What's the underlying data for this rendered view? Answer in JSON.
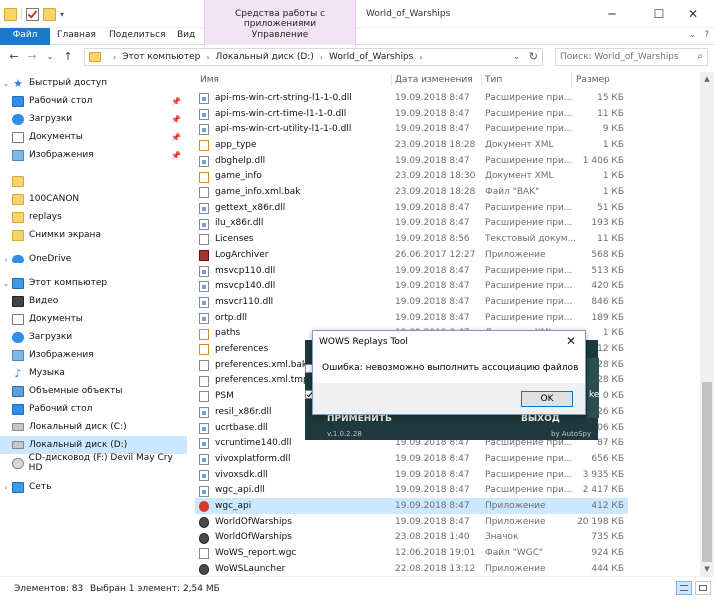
{
  "window": {
    "title": "World_of_Warships",
    "tools_label": "Средства работы с приложениями"
  },
  "ribbon": {
    "tabs": [
      "Файл",
      "Главная",
      "Поделиться",
      "Вид"
    ],
    "manage_label": "Управление"
  },
  "address": {
    "crumbs": [
      "Этот компьютер",
      "Локальный диск (D:)",
      "World_of_Warships"
    ],
    "search_placeholder": "Поиск: World_of_Warships"
  },
  "nav": [
    {
      "label": "Быстрый доступ",
      "icon": "star-icon"
    },
    {
      "label": "Рабочий стол",
      "icon": "desktop-icon",
      "pinned": true
    },
    {
      "label": "Загрузки",
      "icon": "downloads-icon",
      "pinned": true
    },
    {
      "label": "Документы",
      "icon": "documents-icon",
      "pinned": true
    },
    {
      "label": "Изображения",
      "icon": "images-icon",
      "pinned": true
    },
    {
      "label": "",
      "icon": "folder-icon"
    },
    {
      "label": "100CANON",
      "icon": "folder-icon"
    },
    {
      "label": "replays",
      "icon": "folder-icon"
    },
    {
      "label": "Снимки экрана",
      "icon": "folder-icon"
    },
    {
      "label": "OneDrive",
      "icon": "onedrive-icon"
    },
    {
      "label": "Этот компьютер",
      "icon": "computer-icon"
    },
    {
      "label": "Видео",
      "icon": "video-icon"
    },
    {
      "label": "Документы",
      "icon": "documents-icon"
    },
    {
      "label": "Загрузки",
      "icon": "downloads-icon"
    },
    {
      "label": "Изображения",
      "icon": "images-icon"
    },
    {
      "label": "Музыка",
      "icon": "music-icon"
    },
    {
      "label": "Объемные объекты",
      "icon": "3d-objects-icon"
    },
    {
      "label": "Рабочий стол",
      "icon": "desktop-icon"
    },
    {
      "label": "Локальный диск (C:)",
      "icon": "disk-icon"
    },
    {
      "label": "Локальный диск (D:)",
      "icon": "disk-icon",
      "selected": true
    },
    {
      "label": "CD-дисковод (F:) Devil May Cry HD",
      "icon": "cd-icon"
    },
    {
      "label": "Сеть",
      "icon": "network-icon"
    }
  ],
  "columns": {
    "name": "Имя",
    "date": "Дата изменения",
    "type": "Тип",
    "size": "Размер"
  },
  "files": [
    {
      "name": "api-ms-win-crt-string-l1-1-0.dll",
      "date": "19.09.2018 8:47",
      "type": "Расширение при...",
      "size": "15 КБ",
      "icon": "dll"
    },
    {
      "name": "api-ms-win-crt-time-l1-1-0.dll",
      "date": "19.09.2018 8:47",
      "type": "Расширение при...",
      "size": "11 КБ",
      "icon": "dll"
    },
    {
      "name": "api-ms-win-crt-utility-l1-1-0.dll",
      "date": "19.09.2018 8:47",
      "type": "Расширение при...",
      "size": "9 КБ",
      "icon": "dll"
    },
    {
      "name": "app_type",
      "date": "23.09.2018 18:28",
      "type": "Документ XML",
      "size": "1 КБ",
      "icon": "xml"
    },
    {
      "name": "dbghelp.dll",
      "date": "19.09.2018 8:47",
      "type": "Расширение при...",
      "size": "1 406 КБ",
      "icon": "dll"
    },
    {
      "name": "game_info",
      "date": "23.09.2018 18:30",
      "type": "Документ XML",
      "size": "1 КБ",
      "icon": "xml"
    },
    {
      "name": "game_info.xml.bak",
      "date": "23.09.2018 18:28",
      "type": "Файл \"BAK\"",
      "size": "1 КБ",
      "icon": "file"
    },
    {
      "name": "gettext_x86r.dll",
      "date": "19.09.2018 8:47",
      "type": "Расширение при...",
      "size": "51 КБ",
      "icon": "dll"
    },
    {
      "name": "ilu_x86r.dll",
      "date": "19.09.2018 8:47",
      "type": "Расширение при...",
      "size": "193 КБ",
      "icon": "dll"
    },
    {
      "name": "Licenses",
      "date": "19.09.2018 8:56",
      "type": "Текстовый докум...",
      "size": "11 КБ",
      "icon": "file"
    },
    {
      "name": "LogArchiver",
      "date": "26.06.2017 12:27",
      "type": "Приложение",
      "size": "568 КБ",
      "icon": "log"
    },
    {
      "name": "msvcp110.dll",
      "date": "19.09.2018 8:47",
      "type": "Расширение при...",
      "size": "513 КБ",
      "icon": "dll"
    },
    {
      "name": "msvcp140.dll",
      "date": "19.09.2018 8:47",
      "type": "Расширение при...",
      "size": "420 КБ",
      "icon": "dll"
    },
    {
      "name": "msvcr110.dll",
      "date": "19.09.2018 8:47",
      "type": "Расширение при...",
      "size": "846 КБ",
      "icon": "dll"
    },
    {
      "name": "ortp.dll",
      "date": "19.09.2018 8:47",
      "type": "Расширение при...",
      "size": "189 КБ",
      "icon": "dll"
    },
    {
      "name": "paths",
      "date": "19.09.2018 8:47",
      "type": "Документ XML",
      "size": "1 КБ",
      "icon": "xml"
    },
    {
      "name": "preferences",
      "date": "",
      "type": "",
      "size": "412 КБ",
      "icon": "xml"
    },
    {
      "name": "preferences.xml.bak",
      "date": "",
      "type": "",
      "size": "28 КБ",
      "icon": "file"
    },
    {
      "name": "preferences.xml.tmp",
      "date": "",
      "type": "",
      "size": "28 КБ",
      "icon": "file"
    },
    {
      "name": "PSM",
      "date": "",
      "type": "",
      "size": "0 КБ",
      "icon": "file"
    },
    {
      "name": "resil_x86r.dll",
      "date": "",
      "type": "",
      "size": "626 КБ",
      "icon": "dll"
    },
    {
      "name": "ucrtbase.dll",
      "date": "",
      "type": "",
      "size": "106 КБ",
      "icon": "dll"
    },
    {
      "name": "vcruntime140.dll",
      "date": "19.09.2018 8:47",
      "type": "Расширение при...",
      "size": "87 КБ",
      "icon": "dll"
    },
    {
      "name": "vivoxplatform.dll",
      "date": "19.09.2018 8:47",
      "type": "Расширение при...",
      "size": "656 КБ",
      "icon": "dll"
    },
    {
      "name": "vivoxsdk.dll",
      "date": "19.09.2018 8:47",
      "type": "Расширение при...",
      "size": "3 935 КБ",
      "icon": "dll"
    },
    {
      "name": "wgc_api.dll",
      "date": "19.09.2018 8:47",
      "type": "Расширение при...",
      "size": "2 417 КБ",
      "icon": "dll"
    },
    {
      "name": "wgc_api",
      "date": "19.09.2018 8:47",
      "type": "Приложение",
      "size": "412 КБ",
      "icon": "wgc",
      "selected": true
    },
    {
      "name": "WorldOfWarships",
      "date": "19.09.2018 8:47",
      "type": "Приложение",
      "size": "20 198 КБ",
      "icon": "ws"
    },
    {
      "name": "WorldOfWarships",
      "date": "23.08.2018 1:40",
      "type": "Значок",
      "size": "735 КБ",
      "icon": "ws"
    },
    {
      "name": "WoWS_report.wgc",
      "date": "12.06.2018 19:01",
      "type": "Файл \"WGC\"",
      "size": "924 КБ",
      "icon": "file"
    },
    {
      "name": "WoWSLauncher",
      "date": "22.08.2018 13:12",
      "type": "Приложение",
      "size": "444 КБ",
      "icon": "ws"
    }
  ],
  "background_app": {
    "apply": "ПРИМЕНИТЬ",
    "exit": "ВЫХОД",
    "version": "v.1.0.2.28",
    "by": "by AutoSpy",
    "edge_text": "ke"
  },
  "dialog": {
    "title": "WOWS Replays Tool",
    "message": "Ошибка: невозможно выполнить ассоциацию файлов",
    "ok_label": "OK"
  },
  "status": {
    "count": "Элементов: 83",
    "selection": "Выбран 1 элемент: 2,54 МБ"
  }
}
